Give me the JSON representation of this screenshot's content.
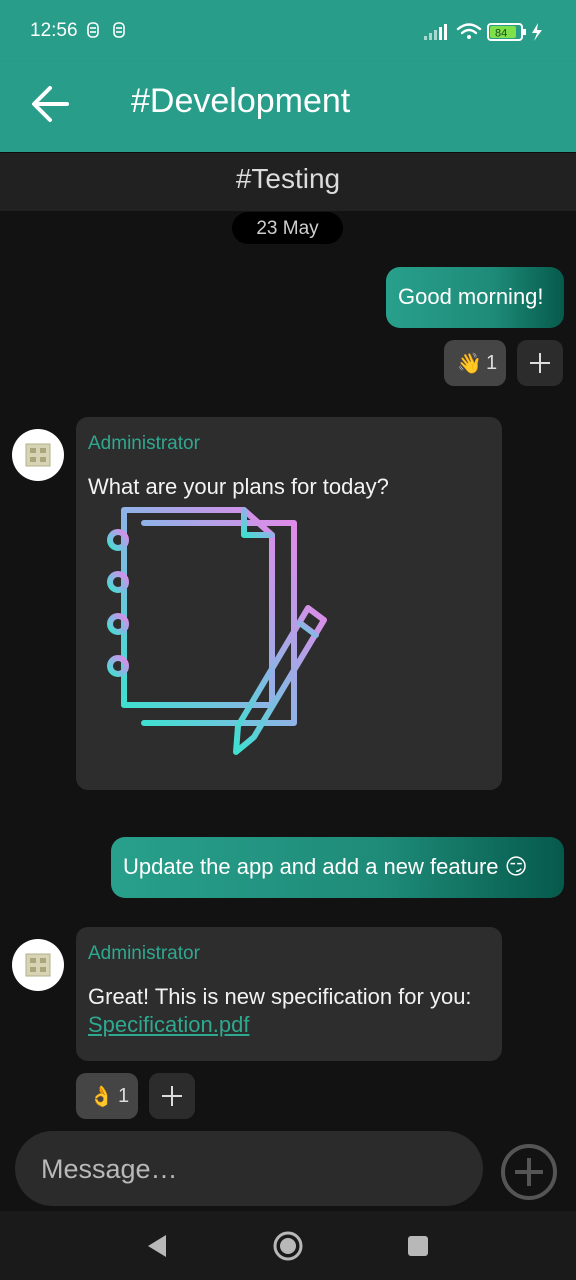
{
  "status_bar": {
    "time": "12:56",
    "battery": "84"
  },
  "app_bar": {
    "title": "#Development"
  },
  "subheader": {
    "title": "#Testing"
  },
  "date_chip": "23 May",
  "messages": [
    {
      "direction": "out",
      "text": "Good morning!"
    },
    {
      "direction": "in",
      "sender": "Administrator",
      "text": "What are your plans for today?",
      "attachment_icon": "notepad-with-pencil-icon"
    },
    {
      "direction": "out",
      "text": "Update the app and add a new feature 😏"
    },
    {
      "direction": "in",
      "sender": "Administrator",
      "text": "Great! This is new specification for you:",
      "link_text": "Specification.pdf"
    }
  ],
  "reactions": {
    "first": {
      "emoji": "👋",
      "count": "1"
    },
    "second": {
      "emoji": "👌",
      "count": "1"
    }
  },
  "composer": {
    "placeholder": "Message…"
  },
  "colors": {
    "accent": "#289e8a",
    "background": "#121212",
    "incoming_bubble": "#2d2d2d",
    "link": "#2fa890"
  },
  "icons": {
    "back": "arrow-left-icon",
    "add_reaction": "plus-icon",
    "composer_add": "circle-plus-icon",
    "nav_back": "triangle-back-icon",
    "nav_home": "circle-home-icon",
    "nav_recents": "square-recents-icon"
  }
}
